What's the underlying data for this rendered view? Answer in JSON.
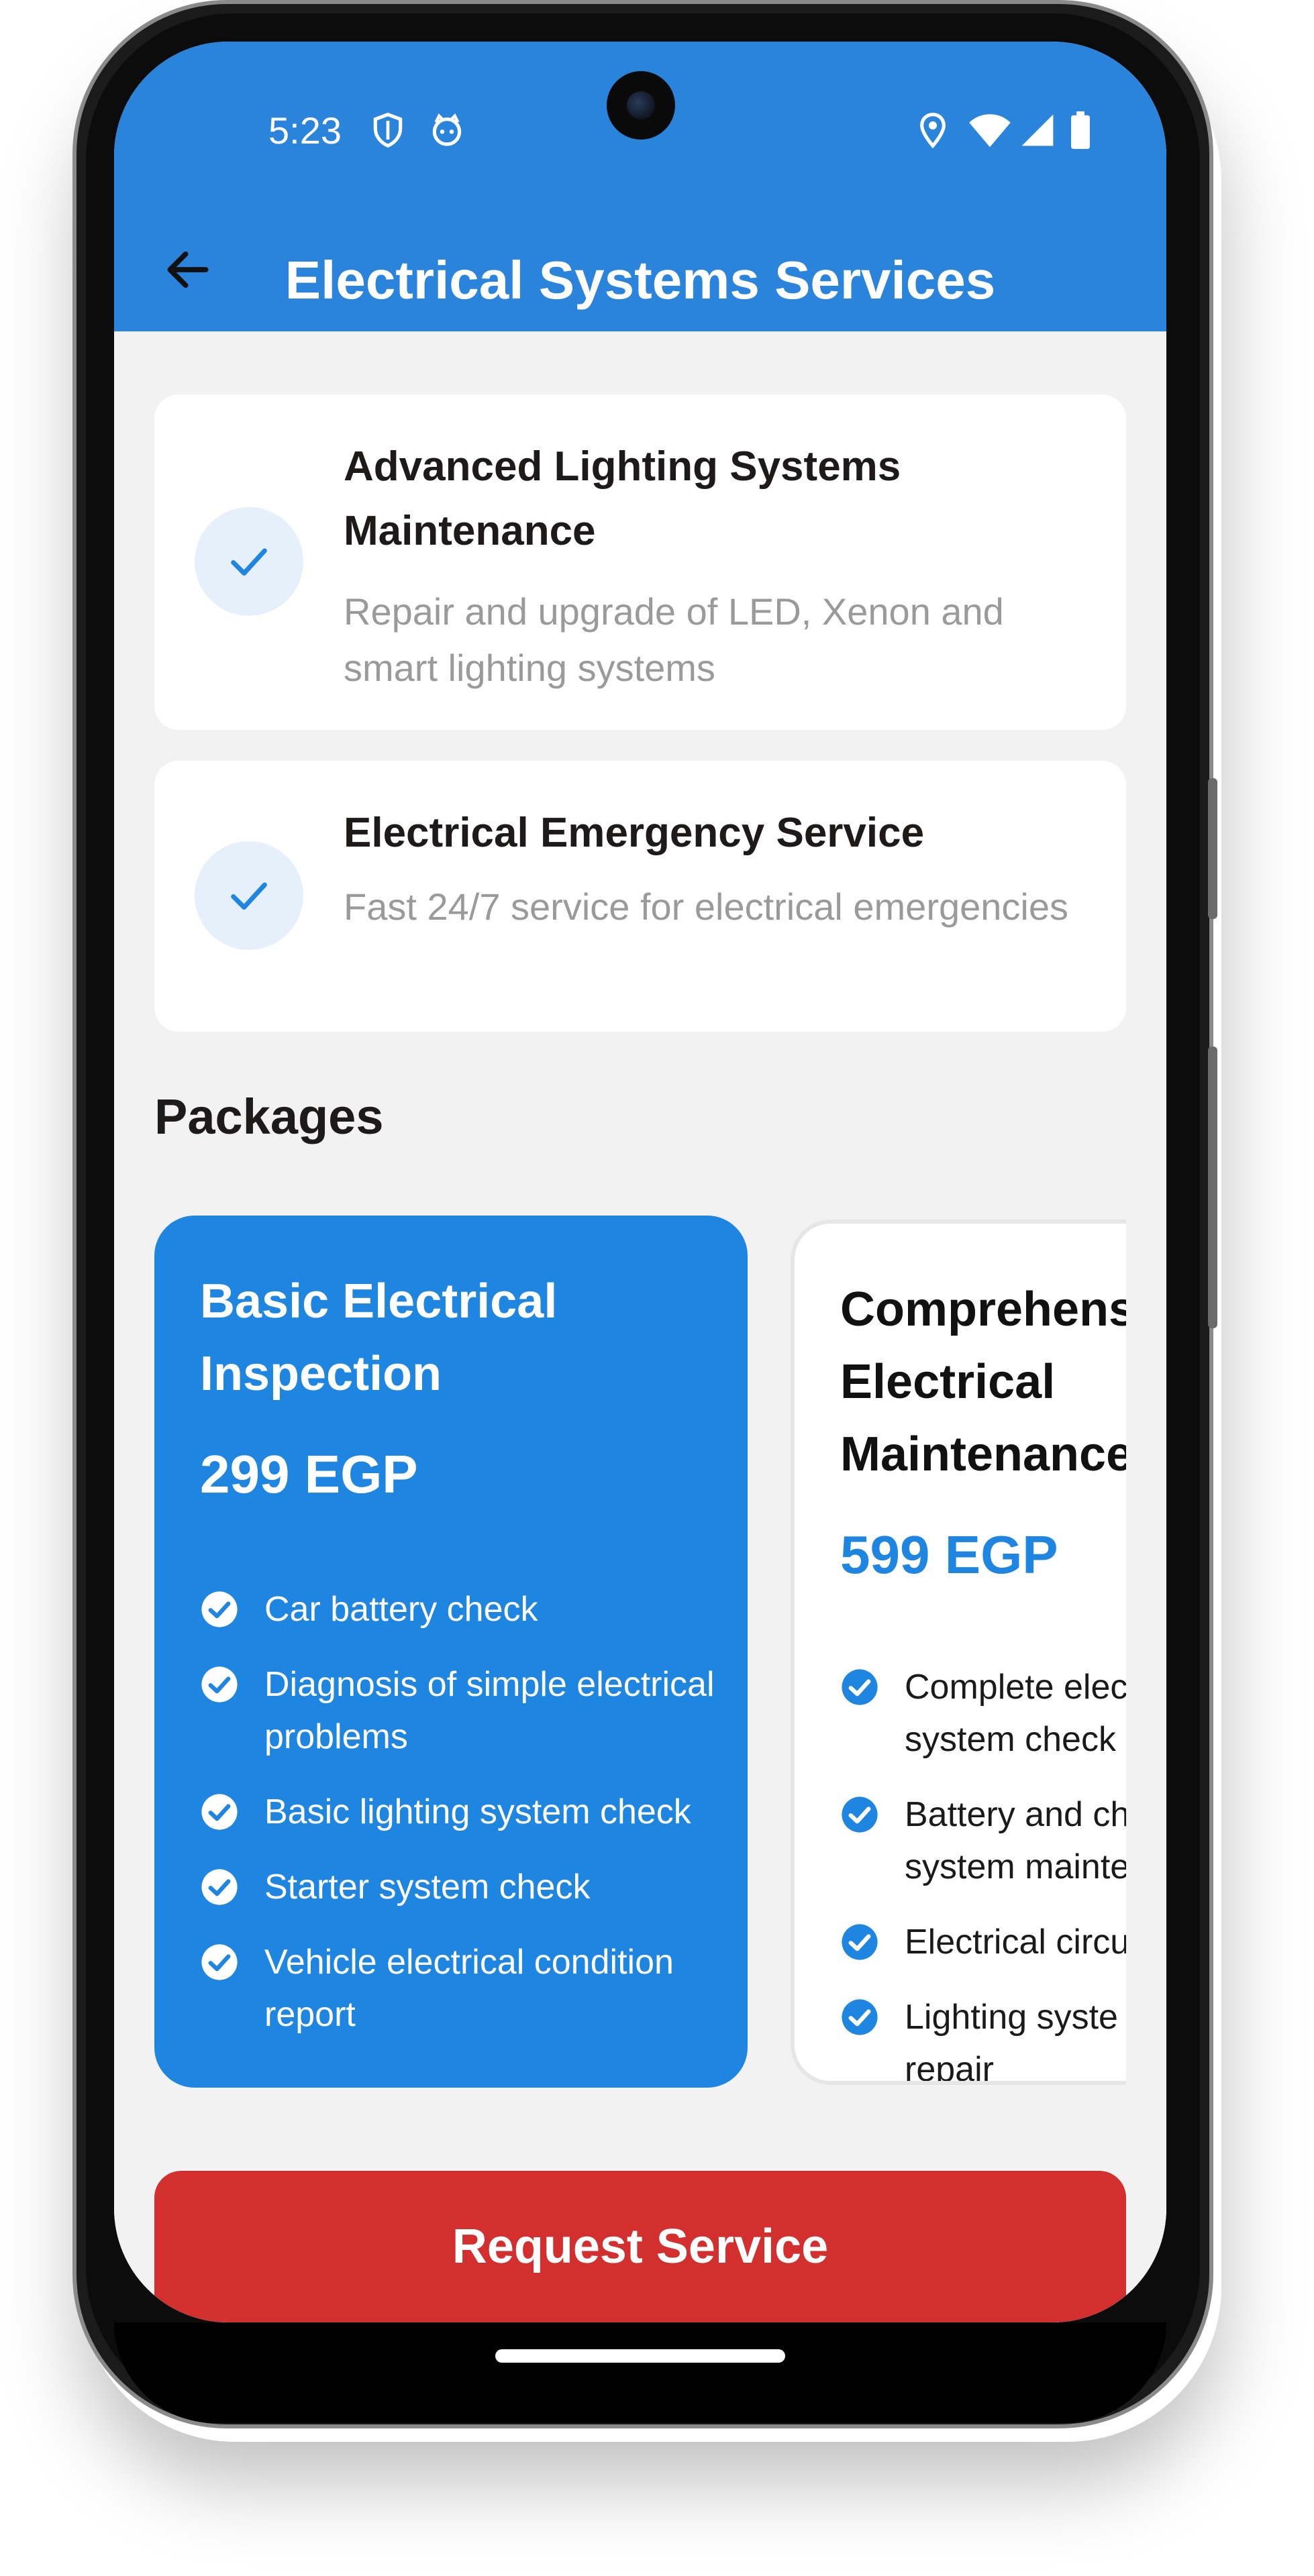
{
  "status_bar": {
    "time": "5:23",
    "icons": [
      "shield-icon",
      "cat-face-icon",
      "location-icon",
      "wifi-icon",
      "signal-icon",
      "battery-icon"
    ]
  },
  "header": {
    "title": "Electrical Systems Services",
    "back_icon": "arrow-back-icon",
    "background_color": "#2a84dc"
  },
  "services": [
    {
      "title": "Advanced Lighting Systems Maintenance",
      "description": "Repair and upgrade of LED, Xenon and smart lighting systems",
      "icon": "check-icon"
    },
    {
      "title": "Electrical Emergency Service",
      "description": "Fast 24/7 service for electrical emergencies",
      "icon": "check-icon"
    }
  ],
  "packages_section": {
    "title": "Packages",
    "packages": [
      {
        "name": "Basic Electrical Inspection",
        "price": "299 EGP",
        "selected": true,
        "features": [
          "Car battery check",
          "Diagnosis of simple electrical problems",
          "Basic lighting system check",
          "Starter system check",
          "Vehicle electrical condition report"
        ]
      },
      {
        "name": "Comprehensi Electrical Maintenance",
        "price": "599 EGP",
        "selected": false,
        "features": [
          "Complete elec system check",
          "Battery and ch system mainte",
          "Electrical circu",
          "Lighting syste repair"
        ]
      }
    ]
  },
  "actions": {
    "request_label": "Request Service",
    "request_color": "#d32f2f"
  },
  "colors": {
    "accent": "#1e86e0",
    "check_bg": "#e6f0fb",
    "page_bg": "#f2f2f2"
  }
}
